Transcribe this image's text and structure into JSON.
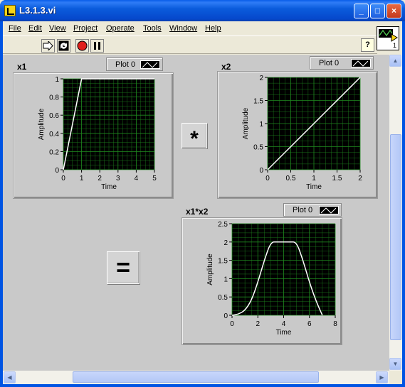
{
  "window": {
    "title": "L3.1.3.vi",
    "min_label": "_",
    "max_label": "□",
    "close_label": "×"
  },
  "menu": [
    "File",
    "Edit",
    "View",
    "Project",
    "Operate",
    "Tools",
    "Window",
    "Help"
  ],
  "toolbar": {
    "help_label": "?",
    "connector_label": "1"
  },
  "operators": {
    "multiply": "*",
    "equals": "="
  },
  "graphs": [
    {
      "label": "x1",
      "legend": "Plot 0",
      "xlabel": "Time",
      "ylabel": "Amplitude",
      "xticks": [
        "0",
        "1",
        "2",
        "3",
        "4",
        "5"
      ],
      "yticks": [
        "0",
        "0.2",
        "0.4",
        "0.6",
        "0.8",
        "1"
      ]
    },
    {
      "label": "x2",
      "legend": "Plot 0",
      "xlabel": "Time",
      "ylabel": "Amplitude",
      "xticks": [
        "0",
        "0.5",
        "1",
        "1.5",
        "2"
      ],
      "yticks": [
        "0",
        "0.5",
        "1",
        "1.5",
        "2"
      ]
    },
    {
      "label": "x1*x2",
      "legend": "Plot 0",
      "xlabel": "Time",
      "ylabel": "Amplitude",
      "xticks": [
        "0",
        "2",
        "4",
        "6",
        "8"
      ],
      "yticks": [
        "0",
        "0.5",
        "1",
        "1.5",
        "2",
        "2.5"
      ]
    }
  ],
  "chart_data": [
    {
      "type": "line",
      "title": "x1",
      "xlabel": "Time",
      "ylabel": "Amplitude",
      "xlim": [
        0,
        5
      ],
      "ylim": [
        0,
        1
      ],
      "grid": true,
      "series": [
        {
          "name": "Plot 0",
          "x": [
            0,
            1,
            5
          ],
          "y": [
            0,
            1,
            1
          ]
        }
      ]
    },
    {
      "type": "line",
      "title": "x2",
      "xlabel": "Time",
      "ylabel": "Amplitude",
      "xlim": [
        0,
        2
      ],
      "ylim": [
        0,
        2
      ],
      "grid": true,
      "series": [
        {
          "name": "Plot 0",
          "x": [
            0,
            2
          ],
          "y": [
            0,
            2
          ]
        }
      ]
    },
    {
      "type": "line",
      "title": "x1*x2",
      "xlabel": "Time",
      "ylabel": "Amplitude",
      "xlim": [
        0,
        8
      ],
      "ylim": [
        0,
        2.5
      ],
      "grid": true,
      "series": [
        {
          "name": "Plot 0",
          "x": [
            0,
            0.5,
            1,
            1.5,
            2,
            2.5,
            3,
            3.5,
            4,
            4.5,
            5,
            5.5,
            6,
            6.5,
            7
          ],
          "y": [
            0,
            0.03,
            0.13,
            0.4,
            0.9,
            1.5,
            2,
            2,
            2,
            2,
            2,
            1.5,
            0.9,
            0.4,
            0
          ]
        }
      ]
    }
  ],
  "colors": {
    "plot_bg": "#000000",
    "grid": "#1f8a1f",
    "trace": "#ffffff",
    "panel": "#c9c9c9"
  }
}
